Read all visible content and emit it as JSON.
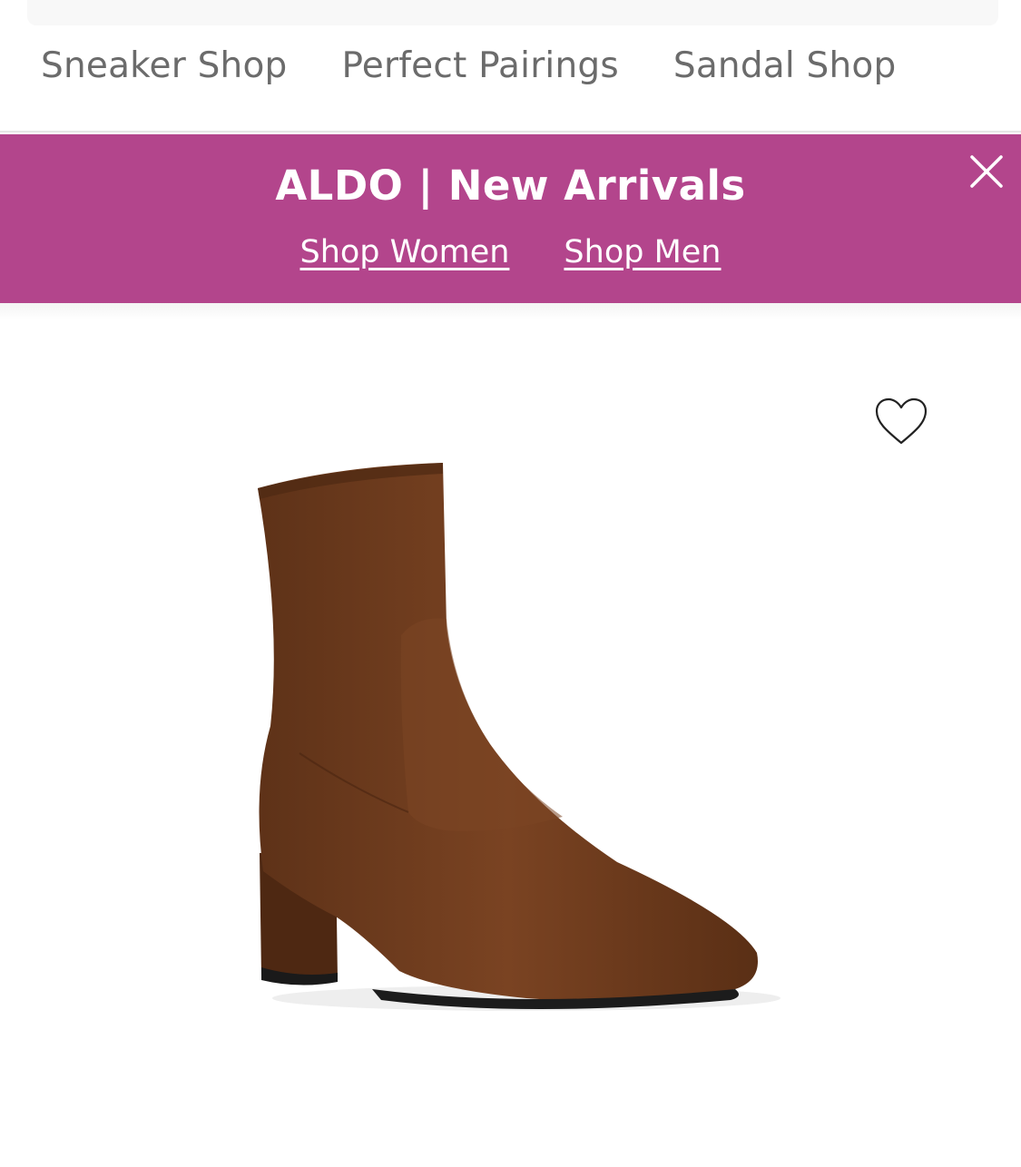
{
  "category_nav": {
    "items": [
      {
        "label": "Sneaker Shop"
      },
      {
        "label": "Perfect Pairings"
      },
      {
        "label": "Sandal Shop"
      }
    ]
  },
  "promo_banner": {
    "title": "ALDO | New Arrivals",
    "links": [
      {
        "label": "Shop Women"
      },
      {
        "label": "Shop Men"
      }
    ],
    "close_icon": "close-icon",
    "background_color": "#b3458c"
  },
  "product": {
    "favorite_icon": "heart-outline-icon",
    "image_icon": "ankle-boot-image",
    "boot_color": "#6b3a1f"
  }
}
